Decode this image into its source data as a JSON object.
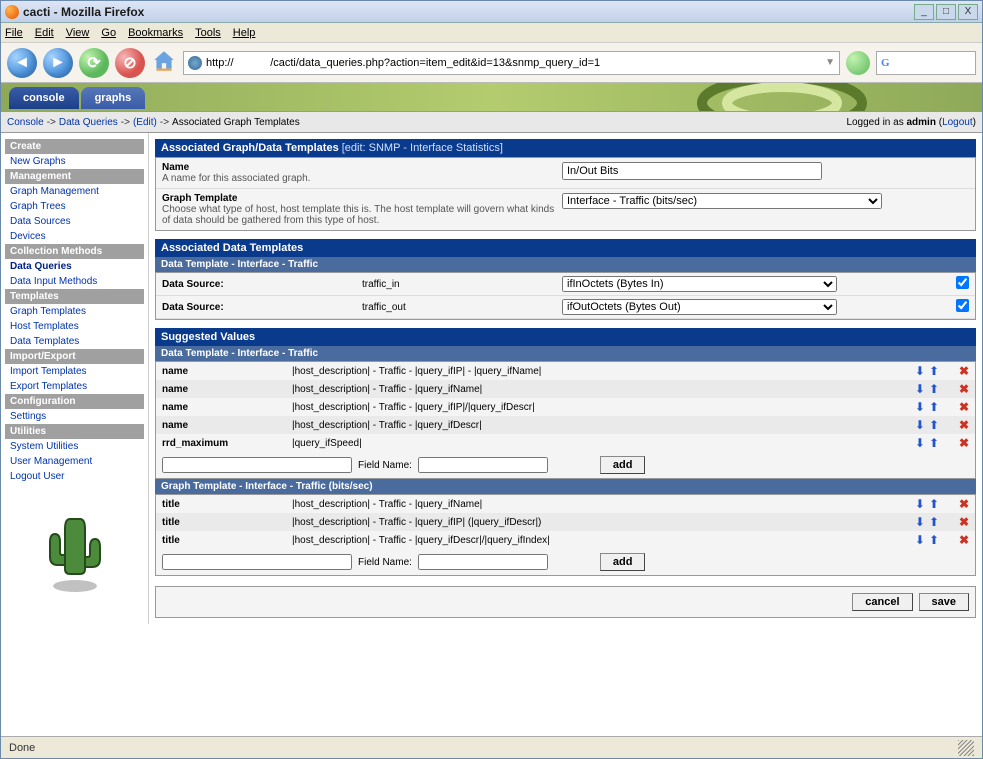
{
  "window": {
    "title": "cacti - Mozilla Firefox"
  },
  "menubar": [
    "File",
    "Edit",
    "View",
    "Go",
    "Bookmarks",
    "Tools",
    "Help"
  ],
  "url": "http://            /cacti/data_queries.php?action=item_edit&id=13&snmp_query_id=1",
  "tabs": {
    "console": "console",
    "graphs": "graphs"
  },
  "breadcrumb": {
    "console": "Console",
    "data_queries": "Data Queries",
    "edit": "(Edit)",
    "tail": "Associated Graph Templates",
    "logged_in_as": "Logged in as",
    "user": "admin",
    "logout": "Logout"
  },
  "sidebar": {
    "sections": [
      {
        "header": "Create",
        "items": [
          {
            "label": "New Graphs"
          }
        ]
      },
      {
        "header": "Management",
        "items": [
          {
            "label": "Graph Management"
          },
          {
            "label": "Graph Trees"
          },
          {
            "label": "Data Sources"
          },
          {
            "label": "Devices"
          }
        ]
      },
      {
        "header": "Collection Methods",
        "items": [
          {
            "label": "Data Queries",
            "active": true
          },
          {
            "label": "Data Input Methods"
          }
        ]
      },
      {
        "header": "Templates",
        "items": [
          {
            "label": "Graph Templates"
          },
          {
            "label": "Host Templates"
          },
          {
            "label": "Data Templates"
          }
        ]
      },
      {
        "header": "Import/Export",
        "items": [
          {
            "label": "Import Templates"
          },
          {
            "label": "Export Templates"
          }
        ]
      },
      {
        "header": "Configuration",
        "items": [
          {
            "label": "Settings"
          }
        ]
      },
      {
        "header": "Utilities",
        "items": [
          {
            "label": "System Utilities"
          },
          {
            "label": "User Management"
          },
          {
            "label": "Logout User"
          }
        ]
      }
    ]
  },
  "panel1": {
    "title": "Associated Graph/Data Templates",
    "sub": "[edit: SNMP - Interface Statistics]",
    "name_label": "Name",
    "name_desc": "A name for this associated graph.",
    "name_value": "In/Out Bits",
    "gt_label": "Graph Template",
    "gt_desc": "Choose what type of host, host template this is. The host template will govern what kinds of data should be gathered from this type of host.",
    "gt_value": "Interface - Traffic (bits/sec)"
  },
  "panel2": {
    "title": "Associated Data Templates",
    "sub": "Data Template - Interface - Traffic",
    "rows": [
      {
        "label": "Data Source:",
        "field": "traffic_in",
        "select": "ifInOctets (Bytes In)",
        "checked": true
      },
      {
        "label": "Data Source:",
        "field": "traffic_out",
        "select": "ifOutOctets (Bytes Out)",
        "checked": true
      }
    ]
  },
  "panel3": {
    "title": "Suggested Values",
    "sub1": "Data Template - Interface - Traffic",
    "dt_rows": [
      {
        "field": "name",
        "val": "|host_description| - Traffic - |query_ifIP| - |query_ifName|"
      },
      {
        "field": "name",
        "val": "|host_description| - Traffic - |query_ifName|"
      },
      {
        "field": "name",
        "val": "|host_description| - Traffic - |query_ifIP|/|query_ifDescr|"
      },
      {
        "field": "name",
        "val": "|host_description| - Traffic - |query_ifDescr|"
      },
      {
        "field": "rrd_maximum",
        "val": "|query_ifSpeed|"
      }
    ],
    "field_name_label": "Field Name:",
    "add_label": "add",
    "sub2": "Graph Template - Interface - Traffic (bits/sec)",
    "gt_rows": [
      {
        "field": "title",
        "val": "|host_description| - Traffic - |query_ifName|"
      },
      {
        "field": "title",
        "val": "|host_description| - Traffic - |query_ifIP| (|query_ifDescr|)"
      },
      {
        "field": "title",
        "val": "|host_description| - Traffic - |query_ifDescr|/|query_ifIndex|"
      }
    ]
  },
  "buttons": {
    "cancel": "cancel",
    "save": "save"
  },
  "status": "Done"
}
